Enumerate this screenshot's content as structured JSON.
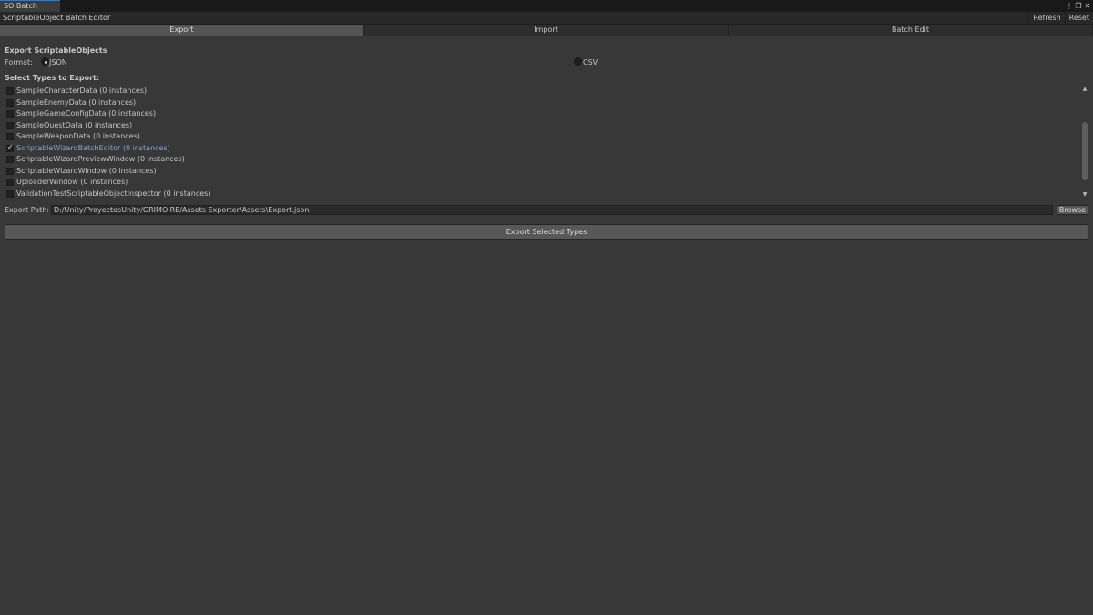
{
  "window": {
    "tab_title": "SO Batch Editor",
    "controls": {
      "menu_glyph": "⋮",
      "maximize_glyph": "❐",
      "close_glyph": "✕"
    }
  },
  "toolbar": {
    "title": "ScriptableObject Batch Editor",
    "refresh_label": "Refresh",
    "reset_label": "Reset"
  },
  "mode_tabs": [
    {
      "label": "Export",
      "active": true
    },
    {
      "label": "Import",
      "active": false
    },
    {
      "label": "Batch Edit",
      "active": false
    }
  ],
  "export": {
    "section_title": "Export ScriptableObjects",
    "format_label": "Format:",
    "formats": [
      {
        "label": "JSON",
        "checked": true
      },
      {
        "label": "CSV",
        "checked": false
      }
    ],
    "types_title": "Select Types to Export:",
    "types": [
      {
        "label": "SampleCharacterData (0 instances)",
        "checked": false
      },
      {
        "label": "SampleEnemyData (0 instances)",
        "checked": false
      },
      {
        "label": "SampleGameConfigData (0 instances)",
        "checked": false
      },
      {
        "label": "SampleQuestData (0 instances)",
        "checked": false
      },
      {
        "label": "SampleWeaponData (0 instances)",
        "checked": false
      },
      {
        "label": "ScriptableWizardBatchEditor (0 instances)",
        "checked": true
      },
      {
        "label": "ScriptableWizardPreviewWindow (0 instances)",
        "checked": false
      },
      {
        "label": "ScriptableWizardWindow (0 instances)",
        "checked": false
      },
      {
        "label": "UploaderWindow (0 instances)",
        "checked": false
      },
      {
        "label": "ValidationTestScriptableObjectInspector (0 instances)",
        "checked": false
      }
    ],
    "path_label": "Export Path:",
    "path_value": "D:/Unity/ProyectosUnity/GRIMOIRE/Assets Exporter/Assets\\Export.json",
    "browse_label": "Browse",
    "export_button_label": "Export Selected Types"
  },
  "colors": {
    "background": "#383838",
    "selected_text": "#7ea6e0",
    "active_tab": "#545454"
  }
}
